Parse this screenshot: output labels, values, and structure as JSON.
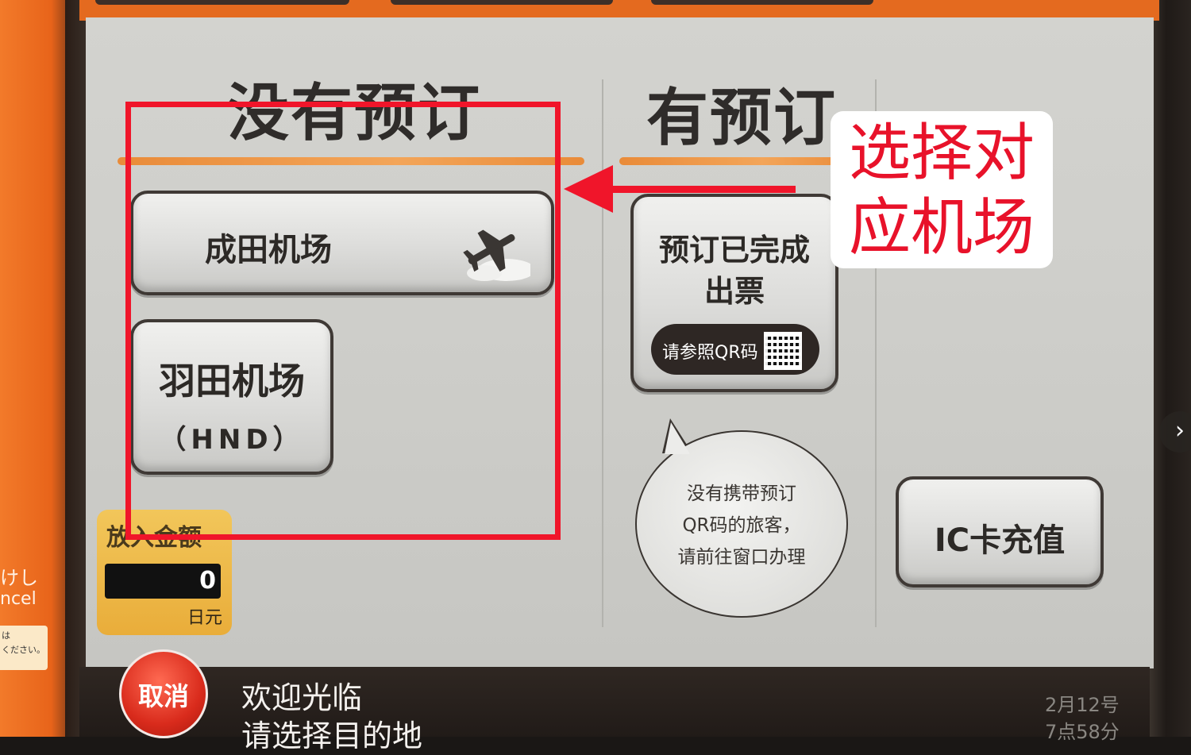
{
  "screen": {
    "no_reservation_title": "没有预订",
    "has_reservation_title": "有预订",
    "buttons": {
      "narita": "成田机场",
      "haneda_line1": "羽田机场",
      "haneda_line2": "（HND）",
      "ticket_line1": "预订已完成",
      "ticket_line2": "出票",
      "qr_hint": "请参照QR码",
      "ic_charge": "IC卡充值"
    },
    "speech_bubble": {
      "line1": "没有携带预订",
      "line2": "QR码的旅客，",
      "line3": "请前往窗口办理"
    },
    "amount": {
      "label": "放入金额",
      "value": "0",
      "unit": "日元"
    }
  },
  "status_bar": {
    "cancel_label": "取消",
    "welcome_line1": "欢迎光临",
    "welcome_line2": "请选择目的地",
    "date": "2月12号",
    "time": "7点58分"
  },
  "side_panel": {
    "label_jp": "けし",
    "label_en": "ncel",
    "note_line1": "は",
    "note_line2": "ください。"
  },
  "annotation": {
    "line1": "选择对",
    "line2": "应机场"
  },
  "colors": {
    "annotation_red": "#f0152a",
    "kiosk_orange": "#e8641a",
    "cancel_red": "#d92b1c"
  }
}
